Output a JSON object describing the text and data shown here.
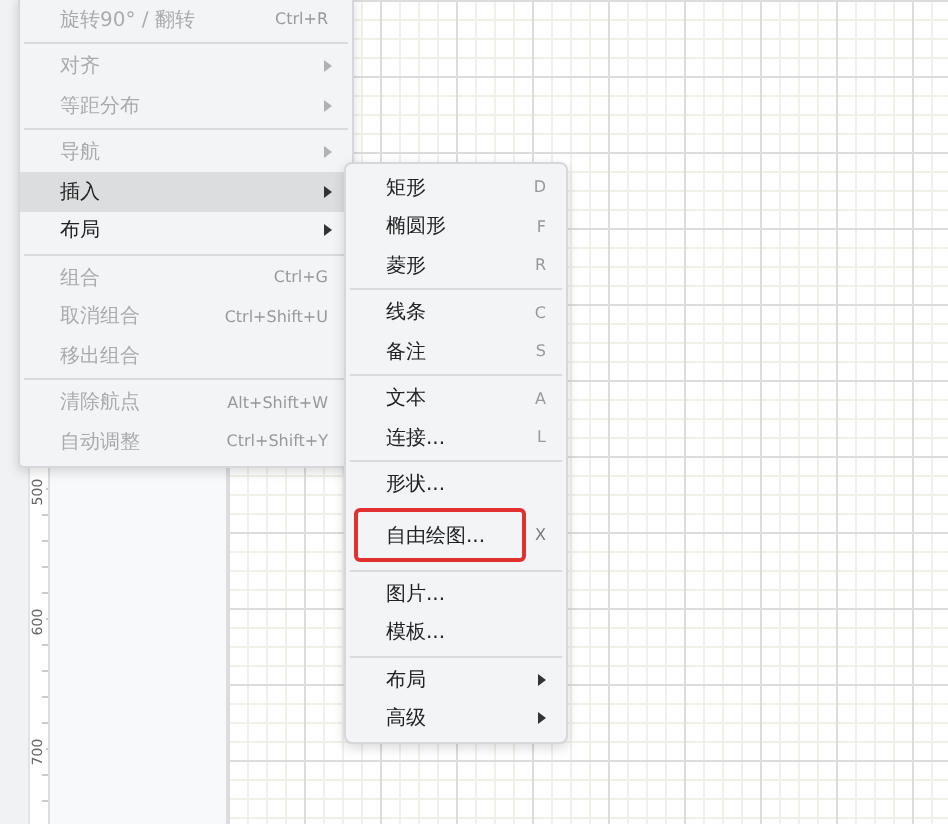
{
  "context_menu": {
    "groups": [
      [
        {
          "label": "旋转90° / 翻转",
          "shortcut": "Ctrl+R",
          "has_submenu": false,
          "disabled": true,
          "selected": false
        }
      ],
      [
        {
          "label": "对齐",
          "has_submenu": true,
          "disabled": true,
          "selected": false
        },
        {
          "label": "等距分布",
          "has_submenu": true,
          "disabled": true,
          "selected": false
        }
      ],
      [
        {
          "label": "导航",
          "has_submenu": true,
          "disabled": true,
          "selected": false
        },
        {
          "label": "插入",
          "has_submenu": true,
          "disabled": false,
          "selected": true
        },
        {
          "label": "布局",
          "has_submenu": true,
          "disabled": false,
          "selected": false
        }
      ],
      [
        {
          "label": "组合",
          "shortcut": "Ctrl+G",
          "has_submenu": false,
          "disabled": true,
          "selected": false
        },
        {
          "label": "取消组合",
          "shortcut": "Ctrl+Shift+U",
          "has_submenu": false,
          "disabled": true,
          "selected": false
        },
        {
          "label": "移出组合",
          "has_submenu": false,
          "disabled": true,
          "selected": false
        }
      ],
      [
        {
          "label": "清除航点",
          "shortcut": "Alt+Shift+W",
          "has_submenu": false,
          "disabled": true,
          "selected": false
        },
        {
          "label": "自动调整",
          "shortcut": "Ctrl+Shift+Y",
          "has_submenu": false,
          "disabled": true,
          "selected": false
        }
      ]
    ]
  },
  "insert_submenu": {
    "groups": [
      [
        {
          "label": "矩形",
          "shortcut": "D",
          "has_submenu": false,
          "highlighted": false
        },
        {
          "label": "椭圆形",
          "shortcut": "F",
          "has_submenu": false,
          "highlighted": false
        },
        {
          "label": "菱形",
          "shortcut": "R",
          "has_submenu": false,
          "highlighted": false
        }
      ],
      [
        {
          "label": "线条",
          "shortcut": "C",
          "has_submenu": false,
          "highlighted": false
        },
        {
          "label": "备注",
          "shortcut": "S",
          "has_submenu": false,
          "highlighted": false
        }
      ],
      [
        {
          "label": "文本",
          "shortcut": "A",
          "has_submenu": false,
          "highlighted": false
        },
        {
          "label": "连接...",
          "shortcut": "L",
          "has_submenu": false,
          "highlighted": false
        }
      ],
      [
        {
          "label": "形状...",
          "has_submenu": false,
          "highlighted": false
        },
        {
          "label": "自由绘图...",
          "shortcut": "X",
          "has_submenu": false,
          "highlighted": true
        }
      ],
      [
        {
          "label": "图片...",
          "has_submenu": false,
          "highlighted": false
        },
        {
          "label": "模板...",
          "has_submenu": false,
          "highlighted": false
        }
      ],
      [
        {
          "label": "布局",
          "has_submenu": true,
          "highlighted": false
        },
        {
          "label": "高级",
          "has_submenu": true,
          "highlighted": false
        }
      ]
    ]
  },
  "ruler": {
    "labels": [
      "500",
      "600",
      "700"
    ]
  }
}
